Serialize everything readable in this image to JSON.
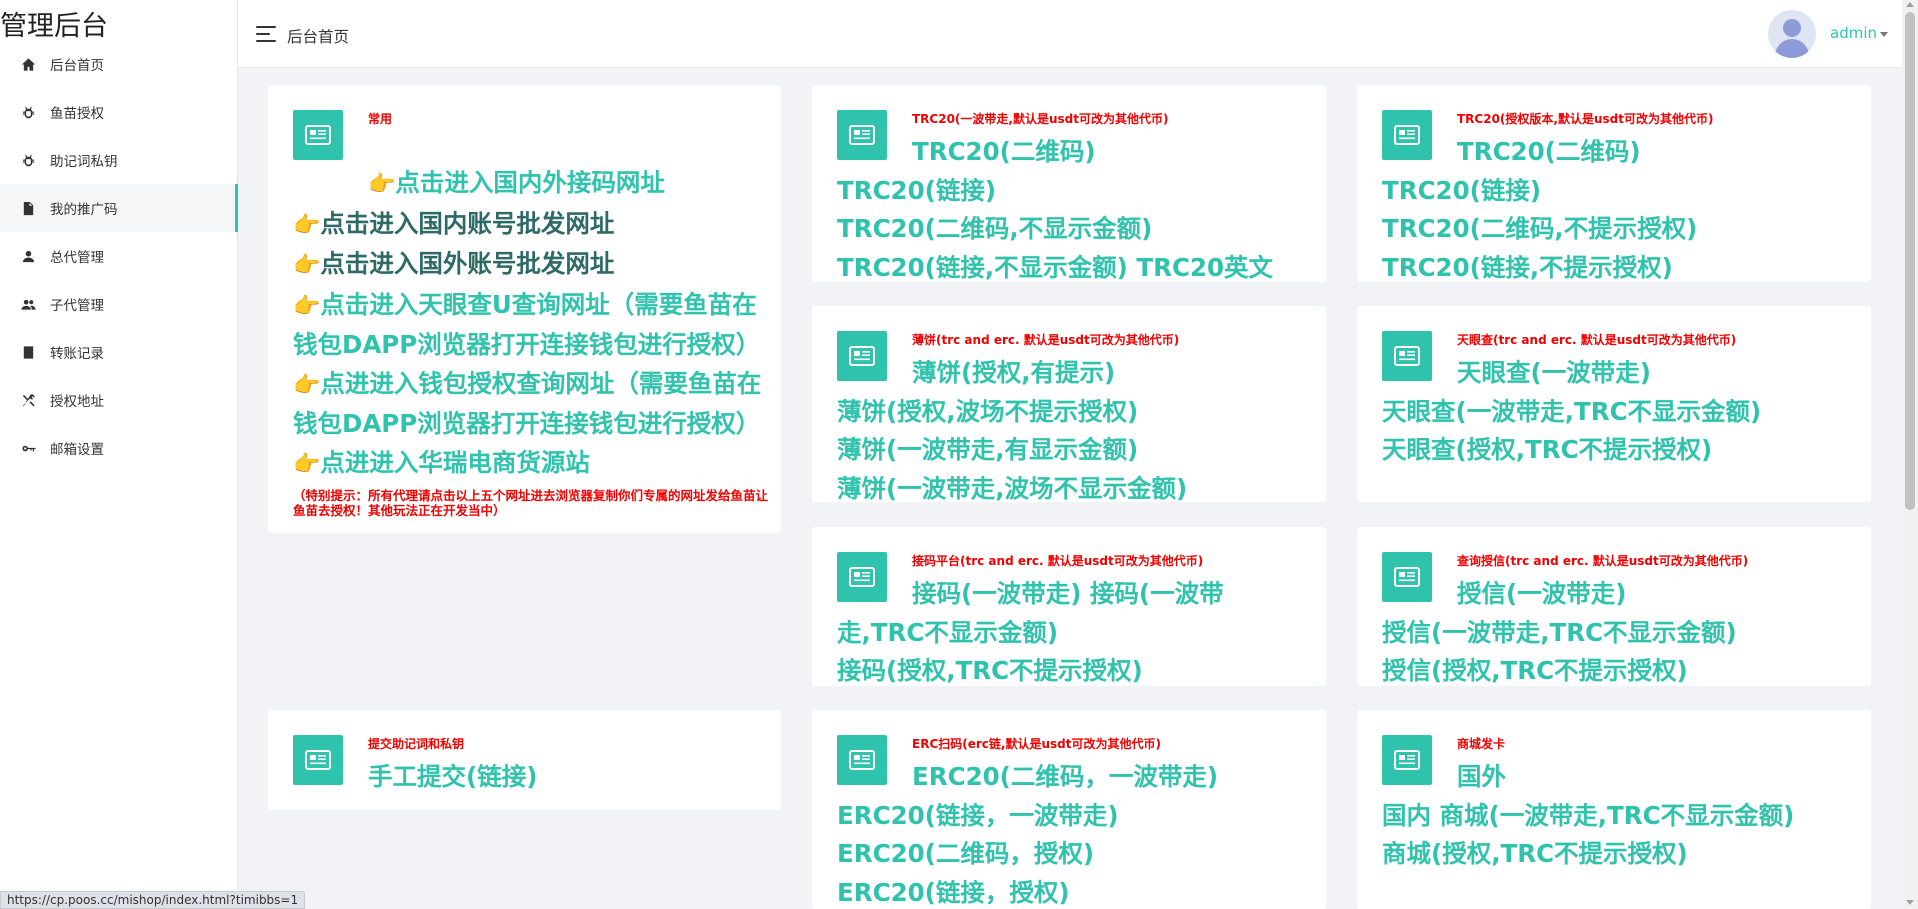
{
  "brand": "管理后台",
  "topbar": {
    "title": "后台首页",
    "user": "admin"
  },
  "sidebar": {
    "items": [
      {
        "label": "后台首页",
        "icon": "home-icon"
      },
      {
        "label": "鱼苗授权",
        "icon": "bug-icon"
      },
      {
        "label": "助记词私钥",
        "icon": "bug-icon"
      },
      {
        "label": "我的推广码",
        "icon": "document-icon",
        "active": true
      },
      {
        "label": "总代管理",
        "icon": "user-icon"
      },
      {
        "label": "子代管理",
        "icon": "users-icon"
      },
      {
        "label": "转账记录",
        "icon": "ledger-icon"
      },
      {
        "label": "授权地址",
        "icon": "tools-icon"
      },
      {
        "label": "邮箱设置",
        "icon": "key-icon"
      }
    ]
  },
  "cards": {
    "common": {
      "title": "常用",
      "emoji": "👉",
      "links": [
        "点击进入国内外接码网址",
        "点击进入国内账号批发网址",
        "点击进入国外账号批发网址",
        "点击进入天眼查U查询网址（需要鱼苗在钱包DAPP浏览器打开连接钱包进行授权）",
        "点进进入钱包授权查询网址（需要鱼苗在钱包DAPP浏览器打开连接钱包进行授权）",
        "点进进入华瑞电商货源站"
      ],
      "note": "（特别提示：所有代理请点击以上五个网址进去浏览器复制你们专属的网址发给鱼苗让鱼苗去授权！其他玩法正在开发当中）"
    },
    "trc20": {
      "title": "TRC20(一波带走,默认是usdt可改为其他代币)",
      "links": [
        "TRC20(二维码)",
        "TRC20(链接)",
        "TRC20(二维码,不显示金额)",
        "TRC20(链接,不显示金额)",
        "TRC20英文"
      ]
    },
    "trc20auth": {
      "title": "TRC20(授权版本,默认是usdt可改为其他代币)",
      "links": [
        "TRC20(二维码)",
        "TRC20(链接)",
        "TRC20(二维码,不提示授权)",
        "TRC20(链接,不提示授权)"
      ]
    },
    "bobing": {
      "title": "薄饼(trc and erc. 默认是usdt可改为其他代币)",
      "links": [
        "薄饼(授权,有提示)",
        "薄饼(授权,波场不提示授权)",
        "薄饼(一波带走,有显示金额)",
        "薄饼(一波带走,波场不显示金额)"
      ]
    },
    "tianyancha": {
      "title": "天眼查(trc and erc. 默认是usdt可改为其他代币)",
      "links": [
        "天眼查(一波带走)",
        "天眼查(一波带走,TRC不显示金额)",
        "天眼查(授权,TRC不提示授权)"
      ]
    },
    "jiema": {
      "title": "接码平台(trc and erc. 默认是usdt可改为其他代币)",
      "links": [
        "接码(一波带走)",
        "接码(一波带走,TRC不显示金额)",
        "接码(授权,TRC不提示授权)"
      ]
    },
    "shouxin": {
      "title": "查询授信(trc and erc. 默认是usdt可改为其他代币)",
      "links": [
        "授信(一波带走)",
        "授信(一波带走,TRC不显示金额)",
        "授信(授权,TRC不提示授权)"
      ]
    },
    "submit": {
      "title": "提交助记词和私钥",
      "links": [
        "手工提交(链接)"
      ]
    },
    "erc": {
      "title": "ERC扫码(erc链,默认是usdt可改为其他代币)",
      "links": [
        "ERC20(二维码，一波带走)",
        "ERC20(链接，一波带走)",
        "ERC20(二维码，授权)",
        "ERC20(链接，授权)"
      ]
    },
    "shop": {
      "title": "商城发卡",
      "links": [
        "国外",
        "国内",
        "商城(一波带走,TRC不显示金额)",
        "商城(授权,TRC不提示授权)"
      ]
    }
  },
  "status_url": "https://cp.poos.cc/mishop/index.html?timibbs=1"
}
